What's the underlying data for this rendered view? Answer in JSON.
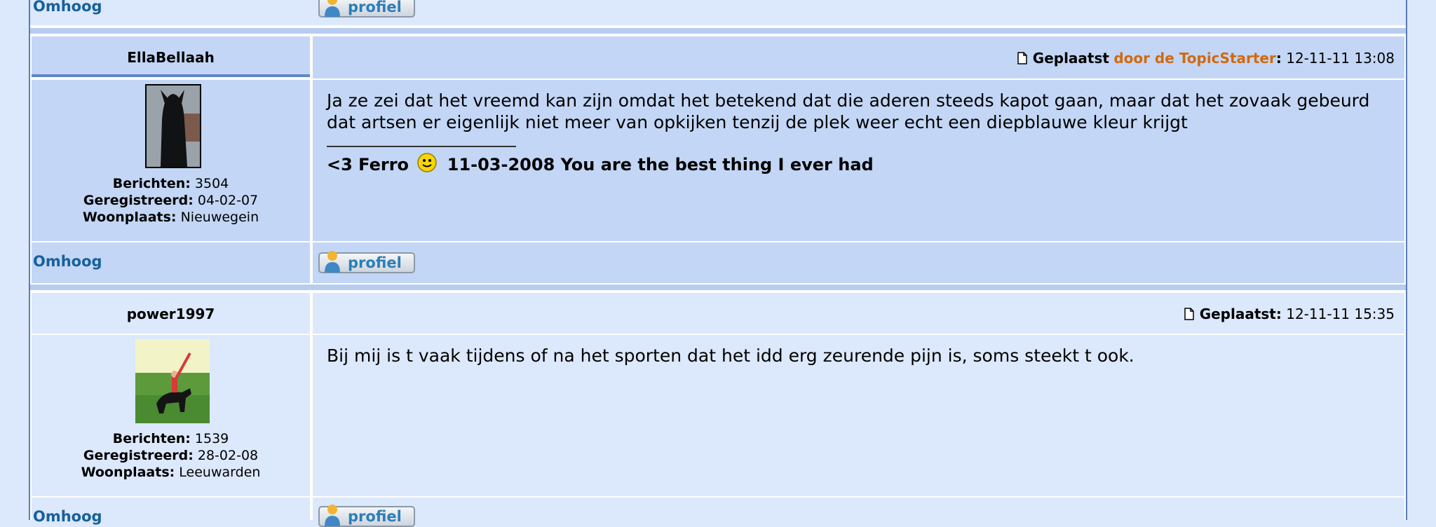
{
  "nav": {
    "top_label": "Omhoog",
    "profile_label": "profiel"
  },
  "posts": [
    {
      "username": "EllaBellaah",
      "posted_label": "Geplaatst",
      "starter_label": "door de TopicStarter",
      "posted_colon": ":",
      "timestamp": "12-11-11 13:08",
      "message": "Ja ze zei dat het vreemd kan zijn omdat het betekend dat die aderen steeds kapot gaan, maar dat het zovaak gebeurd dat artsen er eigenlijk niet meer van opkijken tenzij de plek weer echt een diepblauwe kleur krijgt",
      "signature_before": "<3 Ferro",
      "signature_after": "11-03-2008 You are the best thing I ever had",
      "stats": {
        "posts_label": "Berichten:",
        "posts": "3504",
        "registered_label": "Geregistreerd:",
        "registered": "04-02-07",
        "location_label": "Woonplaats:",
        "location": "Nieuwegein"
      }
    },
    {
      "username": "power1997",
      "posted_label": "Geplaatst:",
      "timestamp": "12-11-11 15:35",
      "message": "Bij mij is t vaak tijdens of na het sporten dat het idd erg zeurende pijn is, soms steekt t ook.",
      "stats": {
        "posts_label": "Berichten:",
        "posts": "1539",
        "registered_label": "Geregistreerd:",
        "registered": "28-02-08",
        "location_label": "Woonplaats:",
        "location": "Leeuwarden"
      }
    }
  ],
  "colors": {
    "accent_link": "#17609b",
    "topicstarter": "#d2690e",
    "row_light": "#dce8fb",
    "row_mid": "#c3d6f5"
  },
  "icons": [
    "document-icon",
    "smiley-icon",
    "profile-person-icon"
  ]
}
